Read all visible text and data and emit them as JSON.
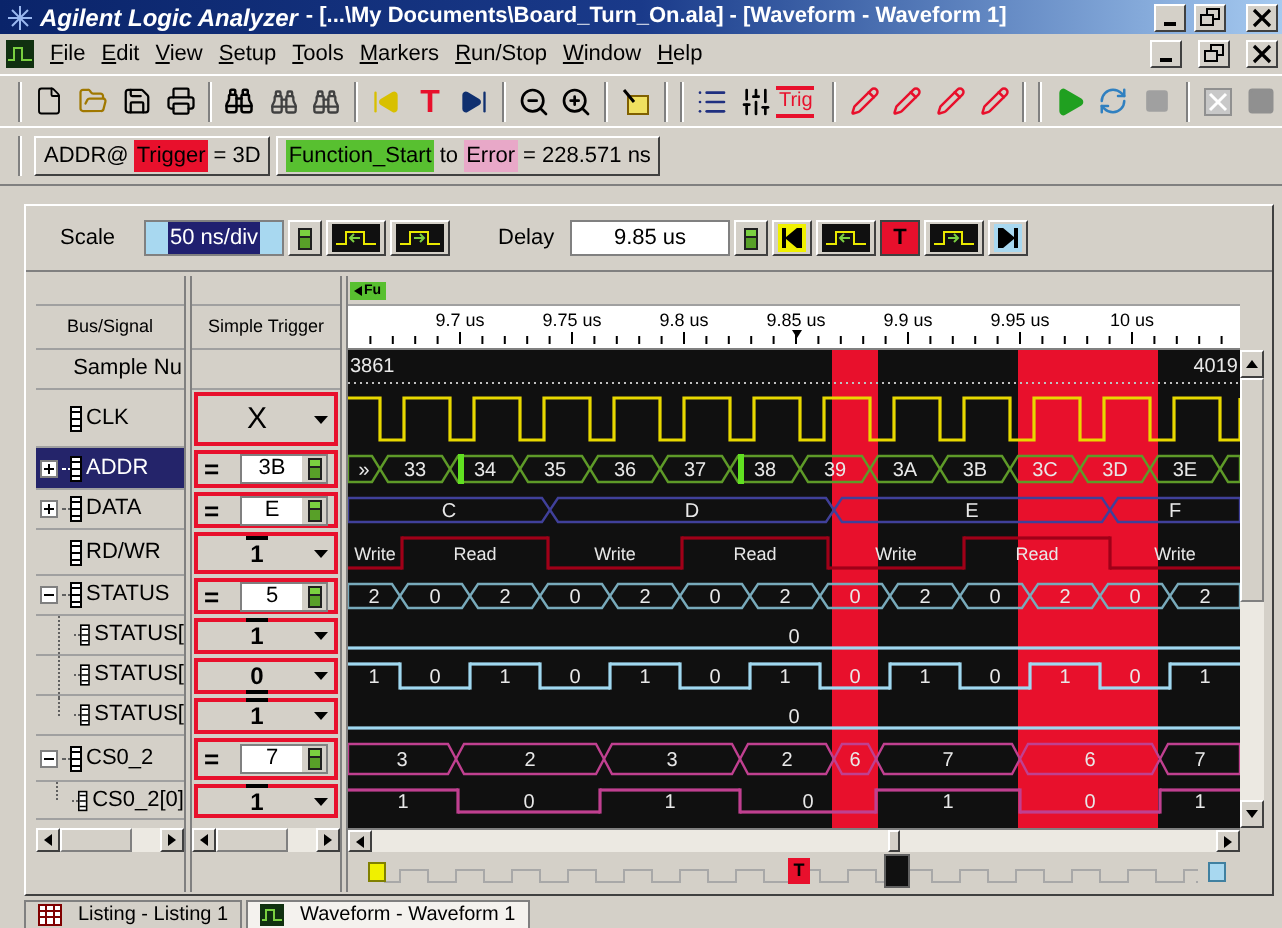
{
  "window": {
    "app": "Agilent Logic Analyzer",
    "title": "- [...\\My Documents\\Board_Turn_On.ala] - [Waveform - Waveform 1]"
  },
  "menu": [
    "File",
    "Edit",
    "View",
    "Setup",
    "Tools",
    "Markers",
    "Run/Stop",
    "Window",
    "Help"
  ],
  "toolbar": {
    "trigger_button": "T",
    "trigger_setup_button": "Trig"
  },
  "marker_readouts": [
    {
      "parts": [
        {
          "text": "ADDR@"
        },
        {
          "text": "Trigger",
          "color": "#e8102c"
        },
        {
          "text": "= 3D"
        }
      ]
    },
    {
      "parts": [
        {
          "text": "Function_Start",
          "color": "#58c030"
        },
        {
          "text": "to"
        },
        {
          "text": "Error",
          "color": "#e8a8c8"
        },
        {
          "text": "= 228.571 ns"
        }
      ]
    }
  ],
  "scale": {
    "label": "Scale",
    "value": "50 ns/div"
  },
  "delay": {
    "label": "Delay",
    "value": "9.85 us",
    "trigger_button": "T"
  },
  "columns": [
    "Bus/Signal",
    "Simple Trigger"
  ],
  "marker_flag": "Fu",
  "ruler": [
    "9.7 us",
    "9.75 us",
    "9.8 us",
    "9.85 us",
    "9.9 us",
    "9.95 us",
    "10 us"
  ],
  "sample": {
    "label": "Sample Nu",
    "first": "3861",
    "last": "4019"
  },
  "signals": [
    {
      "name": "CLK",
      "selected": false,
      "trigger": {
        "kind": "any",
        "value": "X"
      },
      "trace": {
        "kind": "clock",
        "color": "#e8d800"
      }
    },
    {
      "name": "ADDR",
      "selected": true,
      "expanded": false,
      "trigger": {
        "kind": "equals",
        "operator": "=",
        "value": "3B"
      },
      "trace": {
        "kind": "bus",
        "color": "#5e9a28",
        "values": [
          "»",
          "33",
          "34",
          "35",
          "36",
          "37",
          "38",
          "39",
          "3A",
          "3B",
          "3C",
          "3D",
          "3E"
        ]
      }
    },
    {
      "name": "DATA",
      "selected": false,
      "expanded": false,
      "trigger": {
        "kind": "equals",
        "operator": "=",
        "value": "E"
      },
      "trace": {
        "kind": "bus",
        "color": "#40409a",
        "values": [
          "C",
          "D",
          "E",
          "F"
        ]
      }
    },
    {
      "name": "RD/WR",
      "selected": false,
      "trigger": {
        "kind": "high",
        "value": "1"
      },
      "trace": {
        "kind": "bit",
        "color": "#a00018",
        "segments": [
          {
            "label": "Write",
            "high": false
          },
          {
            "label": "Read",
            "high": true
          },
          {
            "label": "Write",
            "high": false
          },
          {
            "label": "Read",
            "high": true
          },
          {
            "label": "Write",
            "high": false
          },
          {
            "label": "Read",
            "high": true
          },
          {
            "label": "Write",
            "high": false
          }
        ]
      }
    },
    {
      "name": "STATUS",
      "selected": false,
      "expanded": true,
      "trigger": {
        "kind": "equals",
        "operator": "=",
        "value": "5"
      },
      "trace": {
        "kind": "bus",
        "color": "#78aabb",
        "values": [
          "2",
          "0",
          "2",
          "0",
          "2",
          "0",
          "2",
          "0",
          "2",
          "0",
          "2",
          "0",
          "2"
        ]
      },
      "children": [
        {
          "name": "STATUS[",
          "selected": false,
          "trigger": {
            "kind": "high",
            "value": "1"
          },
          "trace": {
            "kind": "bit",
            "color": "#a0d8f0",
            "segments": [
              {
                "label": "0",
                "high": false
              }
            ]
          }
        },
        {
          "name": "STATUS[",
          "selected": false,
          "trigger": {
            "kind": "low",
            "value": "0"
          },
          "trace": {
            "kind": "bit",
            "color": "#a0d8f0",
            "segments": [
              {
                "label": "1",
                "high": true
              },
              {
                "label": "0",
                "high": false
              },
              {
                "label": "1",
                "high": true
              },
              {
                "label": "0",
                "high": false
              },
              {
                "label": "1",
                "high": true
              },
              {
                "label": "0",
                "high": false
              },
              {
                "label": "1",
                "high": true
              },
              {
                "label": "0",
                "high": false
              },
              {
                "label": "1",
                "high": true
              },
              {
                "label": "0",
                "high": false
              },
              {
                "label": "1",
                "high": true
              },
              {
                "label": "0",
                "high": false
              },
              {
                "label": "1",
                "high": true
              }
            ]
          }
        },
        {
          "name": "STATUS[",
          "selected": false,
          "trigger": {
            "kind": "high",
            "value": "1"
          },
          "trace": {
            "kind": "bit",
            "color": "#a0d8f0",
            "segments": [
              {
                "label": "0",
                "high": false
              }
            ]
          }
        }
      ]
    },
    {
      "name": "CS0_2",
      "selected": false,
      "expanded": true,
      "trigger": {
        "kind": "equals",
        "operator": "=",
        "value": "7"
      },
      "trace": {
        "kind": "bus",
        "color": "#c04090",
        "values": [
          "3",
          "2",
          "3",
          "2",
          "6",
          "7",
          "6",
          "7"
        ]
      },
      "children": [
        {
          "name": "CS0_2[0]",
          "selected": false,
          "trigger": {
            "kind": "high",
            "value": "1"
          },
          "trace": {
            "kind": "bit",
            "color": "#c04090",
            "segments": [
              {
                "label": "1",
                "high": true
              },
              {
                "label": "0",
                "high": false
              },
              {
                "label": "1",
                "high": true
              },
              {
                "label": "0",
                "high": false
              },
              {
                "label": "1",
                "high": true
              },
              {
                "label": "0",
                "high": false
              },
              {
                "label": "1",
                "high": true
              }
            ]
          }
        }
      ]
    }
  ],
  "overview": {
    "trigger_marker": "T"
  },
  "tabs": [
    {
      "label": "Listing - Listing 1",
      "selected": false
    },
    {
      "label": "Waveform - Waveform 1",
      "selected": true
    }
  ]
}
